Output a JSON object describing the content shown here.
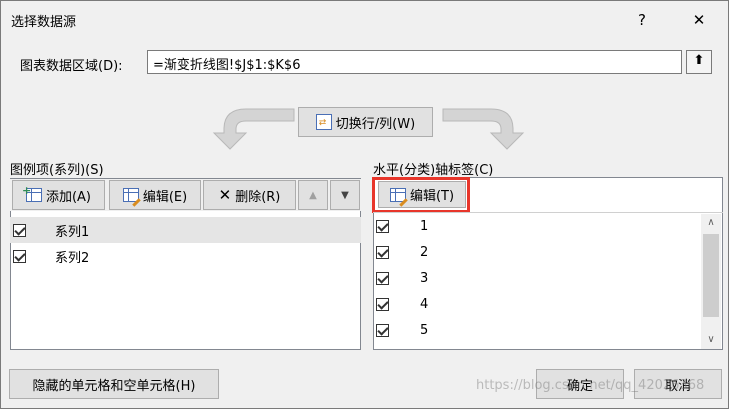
{
  "window": {
    "title": "选择数据源",
    "help_label": "?",
    "close_label": "✕"
  },
  "range": {
    "label": "图表数据区域(D):",
    "value": "=渐变折线图!$J$1:$K$6",
    "collapse_label": "⬆"
  },
  "switch_button": {
    "label": "切换行/列(W)"
  },
  "legend_section": {
    "label": "图例项(系列)(S)",
    "add_label": "添加(A)",
    "edit_label": "编辑(E)",
    "delete_label": "删除(R)",
    "up_label": "▲",
    "down_label": "▼",
    "items": [
      {
        "label": "系列1",
        "checked": true,
        "selected": true
      },
      {
        "label": "系列2",
        "checked": true,
        "selected": false
      }
    ]
  },
  "axis_section": {
    "label": "水平(分类)轴标签(C)",
    "edit_label": "编辑(T)",
    "items": [
      "1",
      "2",
      "3",
      "4",
      "5"
    ]
  },
  "footer": {
    "hidden_cells_label": "隐藏的单元格和空单元格(H)",
    "ok_label": "确定",
    "cancel_label": "取消",
    "watermark": "https://blog.csdn.net/qq_42026368"
  },
  "colors": {
    "highlight": "#e8362b",
    "dialog_bg": "#f0f0f0",
    "selected_row": "#e5e5e5"
  }
}
